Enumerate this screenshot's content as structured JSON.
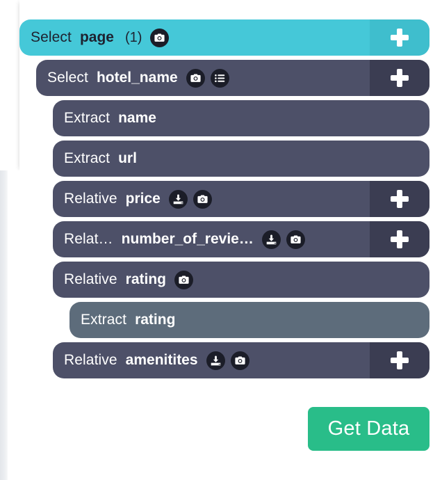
{
  "app": {
    "colors": {
      "teal_row": "#45c8d8",
      "dark_row": "#4d5068",
      "slate_row": "#5d6c7b",
      "plus_dark": "#3b3d52",
      "plus_teal": "#3fbecd",
      "get_data_green": "#29bd89",
      "icon_badge": "#1b1d28"
    }
  },
  "selectors": [
    {
      "type": "Select",
      "name": "page",
      "count": "(1)",
      "style": "teal",
      "indent": 28,
      "icons": [
        "camera-icon"
      ],
      "has_add_button": true
    },
    {
      "type": "Select",
      "name": "hotel_name",
      "count": "",
      "style": "dark",
      "indent": 52,
      "icons": [
        "camera-icon",
        "list-icon"
      ],
      "has_add_button": true
    },
    {
      "type": "Extract",
      "name": "name",
      "count": "",
      "style": "dark",
      "indent": 76,
      "icons": [],
      "has_add_button": false
    },
    {
      "type": "Extract",
      "name": "url",
      "count": "",
      "style": "dark",
      "indent": 76,
      "icons": [],
      "has_add_button": false
    },
    {
      "type": "Relative",
      "name": "price",
      "count": "",
      "style": "dark",
      "indent": 76,
      "icons": [
        "download-icon",
        "camera-icon"
      ],
      "has_add_button": true
    },
    {
      "type": "Relat…",
      "name": "number_of_revie…",
      "count": "",
      "style": "dark",
      "indent": 76,
      "icons": [
        "download-icon",
        "camera-icon"
      ],
      "has_add_button": true
    },
    {
      "type": "Relative",
      "name": "rating",
      "count": "",
      "style": "dark",
      "indent": 76,
      "icons": [
        "camera-icon"
      ],
      "has_add_button": false
    },
    {
      "type": "Extract",
      "name": "rating",
      "count": "",
      "style": "slate",
      "indent": 100,
      "icons": [],
      "has_add_button": false
    },
    {
      "type": "Relative",
      "name": "amenitites",
      "count": "",
      "style": "dark",
      "indent": 76,
      "icons": [
        "download-icon",
        "camera-icon"
      ],
      "has_add_button": true
    }
  ],
  "actions": {
    "get_data_label": "Get Data"
  }
}
